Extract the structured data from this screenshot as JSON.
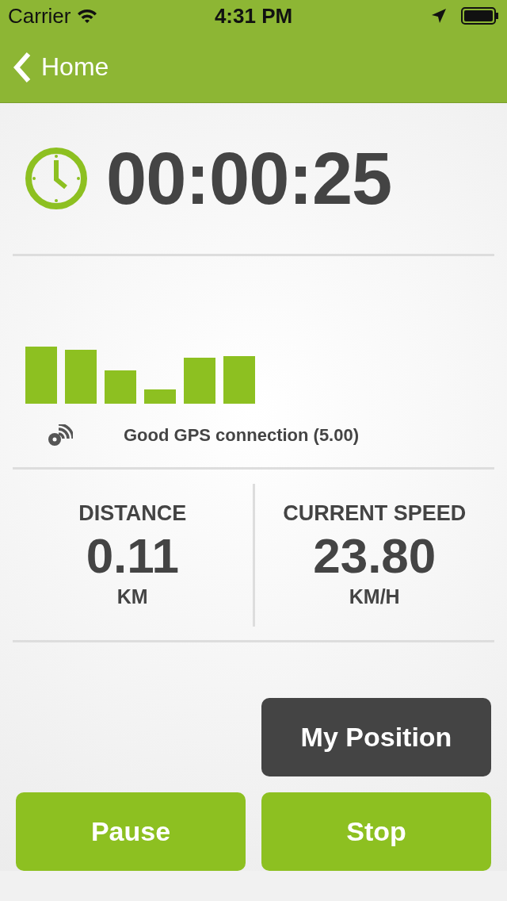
{
  "status_bar": {
    "carrier": "Carrier",
    "time": "4:31 PM"
  },
  "nav_bar": {
    "back_label": "Home"
  },
  "timer": {
    "elapsed": "00:00:25"
  },
  "gps": {
    "status": "Good GPS connection (5.00)"
  },
  "stats": [
    {
      "label": "DISTANCE",
      "value": "0.11",
      "unit": "KM"
    },
    {
      "label": "CURRENT SPEED",
      "value": "23.80",
      "unit": "KM/H"
    }
  ],
  "buttons": [
    {
      "label": "My Position",
      "kind": "dark"
    },
    {
      "label": "Pause",
      "kind": "green"
    },
    {
      "label": "Stop",
      "kind": "green"
    }
  ]
}
